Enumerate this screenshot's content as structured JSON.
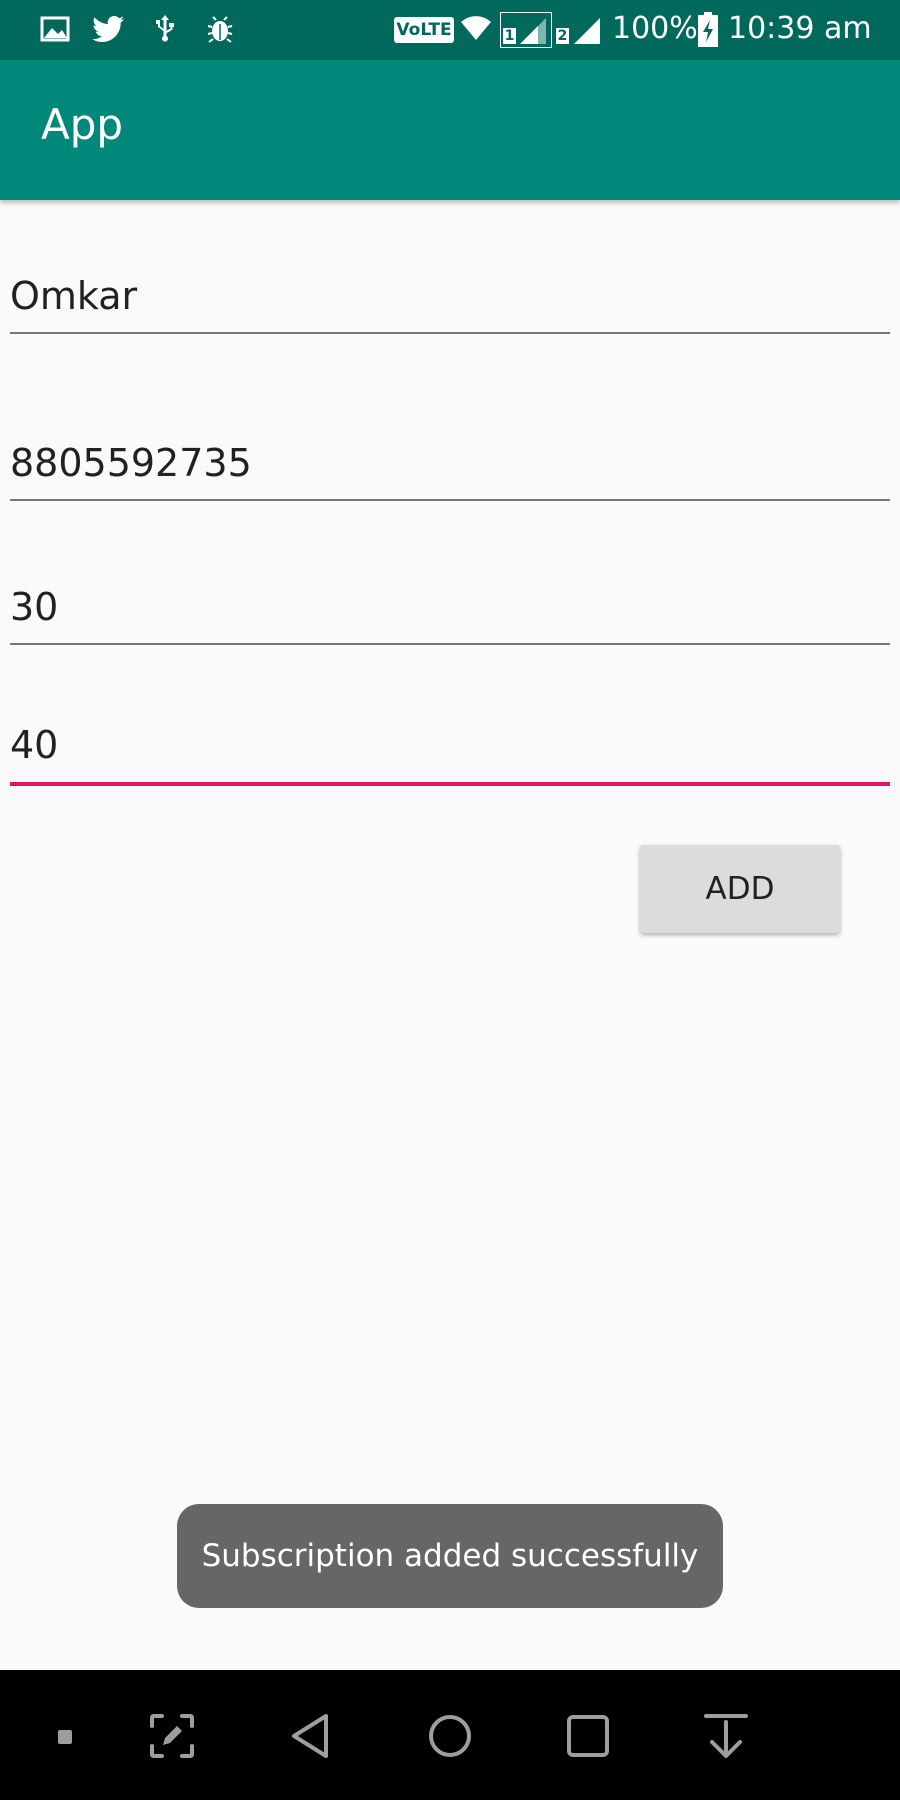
{
  "status_bar": {
    "left_icons": [
      "image-icon",
      "twitter-icon",
      "usb-icon",
      "bug-icon"
    ],
    "network_label": "VoLTE",
    "sim1_label": "1",
    "sim2_label": "2",
    "battery": "100%",
    "time": "10:39 am"
  },
  "app_bar": {
    "title": "App",
    "color": "#00897b"
  },
  "form": {
    "field1_value": "Omkar",
    "field2_value": "8805592735",
    "field3_value": "30",
    "field4_value": "40",
    "add_label": "ADD",
    "focus_color": "#d81b60"
  },
  "toast": {
    "message": "Subscription added successfully"
  },
  "nav_bar": {
    "icons": [
      "dot-icon",
      "screenshot-edit-icon",
      "back-icon",
      "home-icon",
      "recents-icon",
      "pull-down-icon"
    ]
  }
}
